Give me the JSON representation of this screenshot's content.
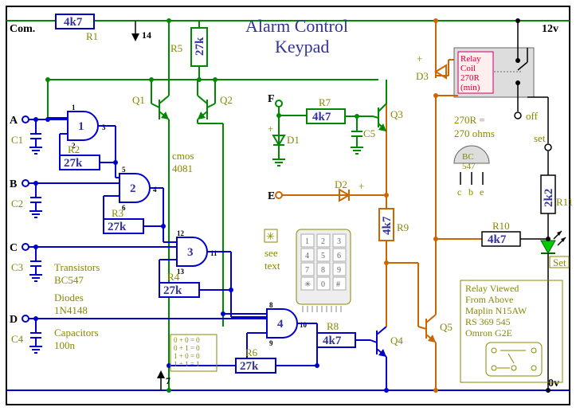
{
  "title1": "Alarm Control",
  "title2": "Keypad",
  "rails": {
    "top": "12v",
    "bottom": "0v",
    "com": "Com.",
    "off": "off",
    "set": "set"
  },
  "pins": {
    "A": "A",
    "B": "B",
    "C": "C",
    "D": "D",
    "E": "E",
    "F": "F",
    "pin14": "14",
    "pin7": "7"
  },
  "gates": {
    "g1": "1",
    "g2": "2",
    "g3": "3",
    "g4": "4",
    "p1": "1",
    "p2": "2",
    "p3": "3",
    "p5": "5",
    "p6": "6",
    "p4": "4",
    "p12": "12",
    "p13": "13",
    "p11": "11",
    "p8": "8",
    "p9": "9",
    "p10": "10",
    "ic": "cmos",
    "ic2": "4081"
  },
  "r": {
    "R1": "R1",
    "R1v": "4k7",
    "R2": "R2",
    "R2v": "27k",
    "R3": "R3",
    "R3v": "27k",
    "R4": "R4",
    "R4v": "27k",
    "R5": "R5",
    "R5v": "27k",
    "R6": "R6",
    "R6v": "27k",
    "R7": "R7",
    "R7v": "4k7",
    "R8": "R8",
    "R8v": "4k7",
    "R9": "R9",
    "R9v": "4k7",
    "R10": "R10",
    "R10v": "4k7",
    "R11": "R11",
    "R11v": "2k2"
  },
  "c": {
    "C1": "C1",
    "C2": "C2",
    "C3": "C3",
    "C4": "C4",
    "C5": "C5"
  },
  "d": {
    "D1": "D1",
    "D2": "D2",
    "D3": "D3",
    "plusa": "+",
    "plusb": "+",
    "plusc": "+"
  },
  "q": {
    "Q1": "Q1",
    "Q2": "Q2",
    "Q3": "Q3",
    "Q4": "Q4",
    "Q5": "Q5"
  },
  "relay": {
    "l1": "Relay",
    "l2": "Coil",
    "l3": "270R",
    "l4": "(min)",
    "note1": "270R =",
    "note2": "270 ohms"
  },
  "bc": {
    "label": "BC",
    "label2": "547",
    "c": "c",
    "b": "b",
    "e": "e"
  },
  "led": "Set",
  "notes": {
    "trans": "Transistors",
    "transv": "BC547",
    "dio": "Diodes",
    "diov": "1N4148",
    "cap": "Capacitors",
    "capv": "100n",
    "see1": "see",
    "see2": "text",
    "star": "✳"
  },
  "truth": [
    "0 + 0 = 0",
    "0 + 1 = 0",
    "1 + 0 = 0",
    "1 + 1 = 1"
  ],
  "keypad": [
    "1",
    "2",
    "3",
    "4",
    "5",
    "6",
    "7",
    "8",
    "9",
    "✳",
    "0",
    "#"
  ],
  "relayview": {
    "l1": "Relay Viewed",
    "l2": "From Above",
    "l3": "Maplin N15AW",
    "l4": "RS 369 545",
    "l5": "Omron G2E"
  }
}
